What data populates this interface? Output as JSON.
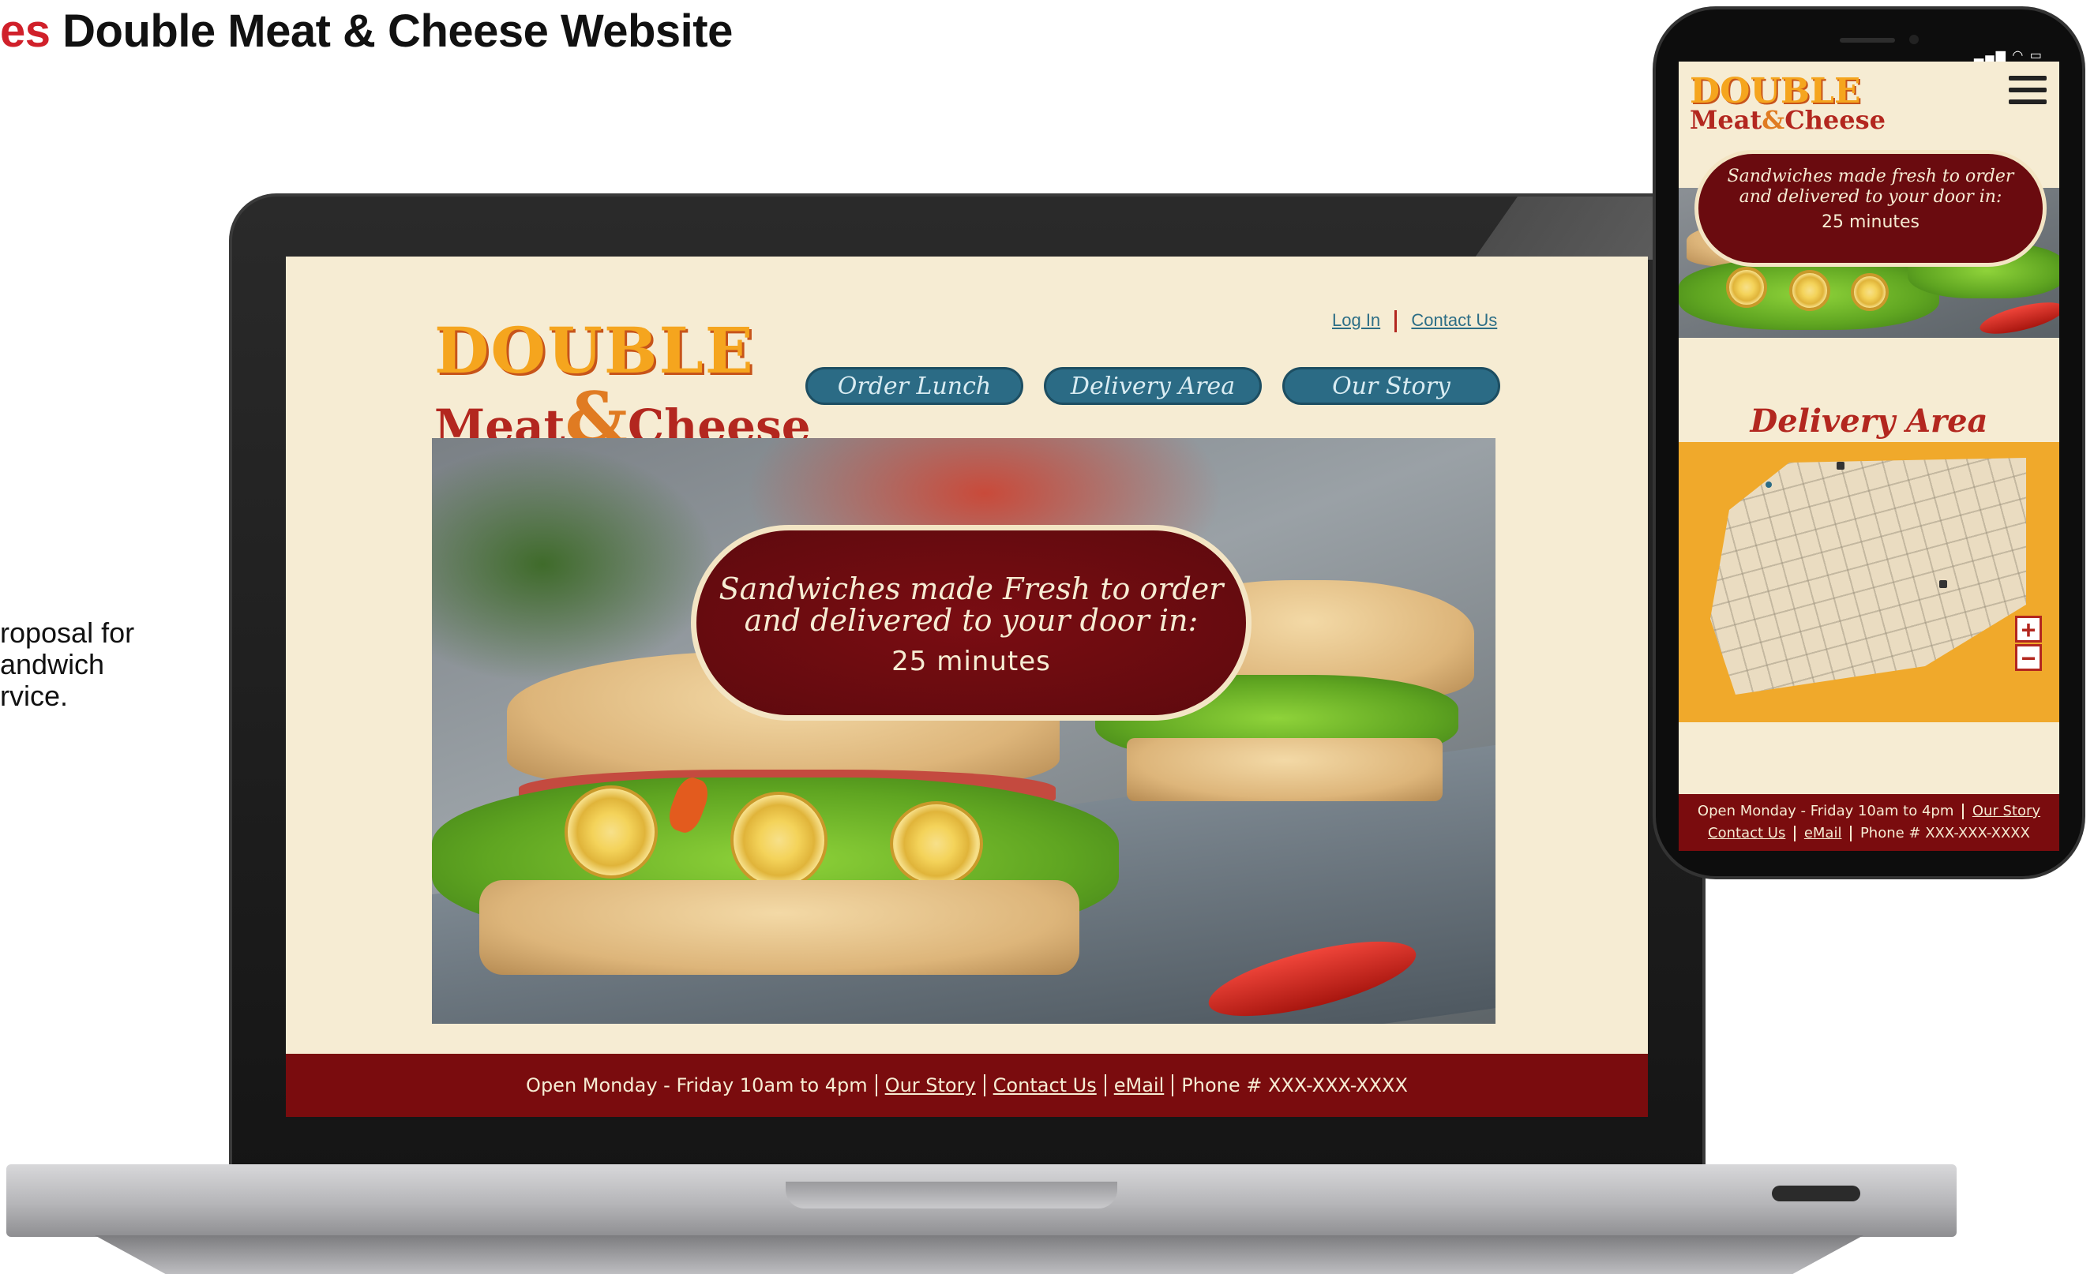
{
  "page": {
    "heading_accent": "es",
    "heading_main": "Double Meat & Cheese Website",
    "side_description": "roposal for\nandwich\nrvice."
  },
  "brand": {
    "logo_line1": "DOUBLE",
    "logo_line2_left": "Meat",
    "logo_amp": "&",
    "logo_line2_right": "Cheese",
    "colors": {
      "cream": "#f6ecd3",
      "maroon": "#7a0c0e",
      "teal": "#2b6b85",
      "orange": "#f5a51e",
      "red": "#b3271f"
    }
  },
  "desktop": {
    "top_links": {
      "login": "Log In",
      "contact": "Contact Us"
    },
    "nav": [
      "Order Lunch",
      "Delivery Area",
      "Our Story"
    ],
    "hero": {
      "tagline": "Sandwiches made Fresh to order\nand delivered to your door in:",
      "delivery_time": "25 minutes"
    },
    "footer": {
      "hours": "Open Monday - Friday 10am to 4pm",
      "our_story": "Our Story",
      "contact": "Contact Us",
      "email": "eMail",
      "phone": "Phone # XXX-XXX-XXXX"
    }
  },
  "mobile": {
    "hero": {
      "tagline": "Sandwiches made fresh to order\nand delivered to your door in:",
      "delivery_time": "25 minutes"
    },
    "section_title": "Delivery Area",
    "zoom_in": "+",
    "zoom_out": "−",
    "footer": {
      "hours": "Open Monday - Friday 10am to 4pm",
      "our_story": "Our Story",
      "contact": "Contact Us",
      "email": "eMail",
      "phone": "Phone # XXX-XXX-XXXX"
    },
    "icons": [
      "hamburger-menu-icon",
      "zoom-in-icon",
      "zoom-out-icon"
    ]
  }
}
